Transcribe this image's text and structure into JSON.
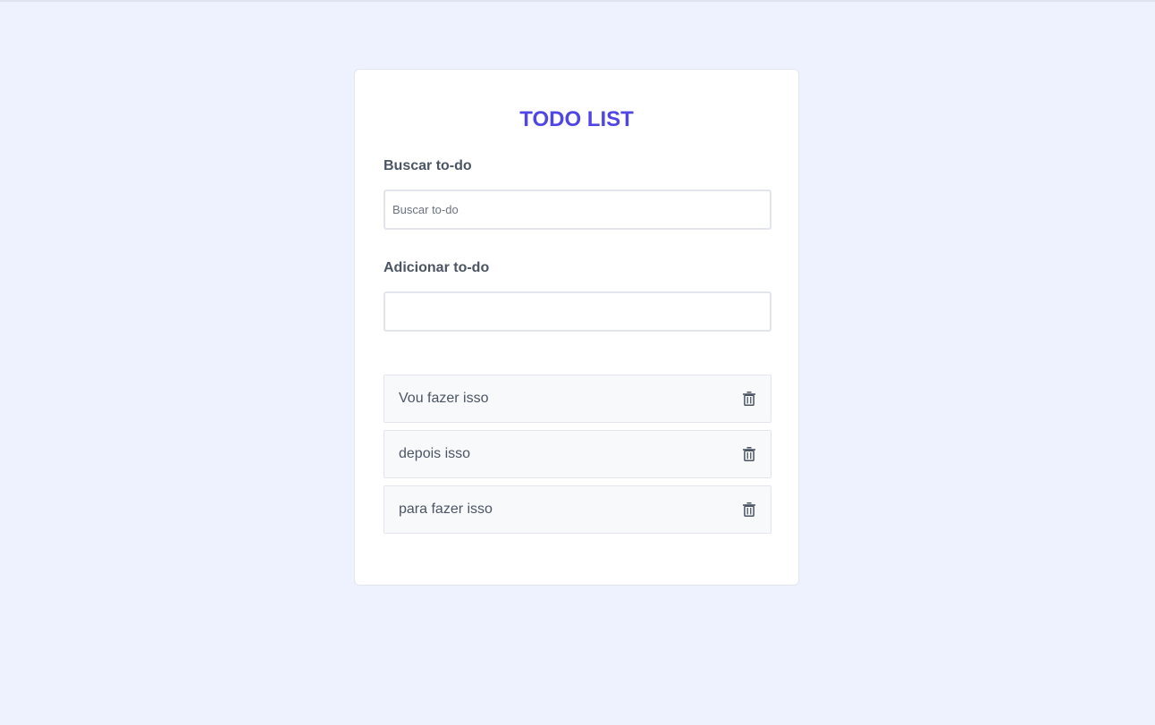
{
  "app": {
    "title": "TODO LIST"
  },
  "search": {
    "label": "Buscar to-do",
    "placeholder": "Buscar to-do",
    "value": ""
  },
  "add": {
    "label": "Adicionar to-do",
    "placeholder": "",
    "value": ""
  },
  "todos": [
    {
      "text": "Vou fazer isso",
      "icon": "trash-icon"
    },
    {
      "text": "depois isso",
      "icon": "trash-icon"
    },
    {
      "text": "para fazer isso",
      "icon": "trash-icon"
    }
  ],
  "colors": {
    "page_background": "#eef2fe",
    "accent": "#4f46e5",
    "label_text": "#4b5563",
    "item_background": "#f8f9fb",
    "border": "#e2e5eb"
  }
}
